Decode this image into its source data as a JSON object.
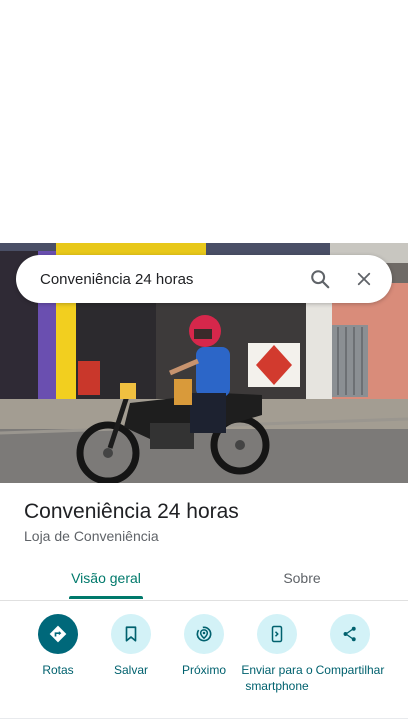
{
  "search": {
    "query": "Conveniência 24 horas",
    "search_icon": "search-icon",
    "close_icon": "close-icon"
  },
  "place": {
    "name": "Conveniência 24 horas",
    "category": "Loja de Conveniência"
  },
  "tabs": [
    {
      "label": "Visão geral",
      "selected": true
    },
    {
      "label": "Sobre",
      "selected": false
    }
  ],
  "actions": [
    {
      "label": "Rotas",
      "icon": "directions-icon"
    },
    {
      "label": "Salvar",
      "icon": "bookmark-icon"
    },
    {
      "label": "Próximo",
      "icon": "nearby-icon"
    },
    {
      "label": "Enviar para o smartphone",
      "icon": "send-to-phone-icon"
    },
    {
      "label": "Compartilhar",
      "icon": "share-icon"
    }
  ],
  "colors": {
    "accent": "#00796b",
    "action_bg": "#d3f2f7",
    "primary_action": "#00687a"
  }
}
